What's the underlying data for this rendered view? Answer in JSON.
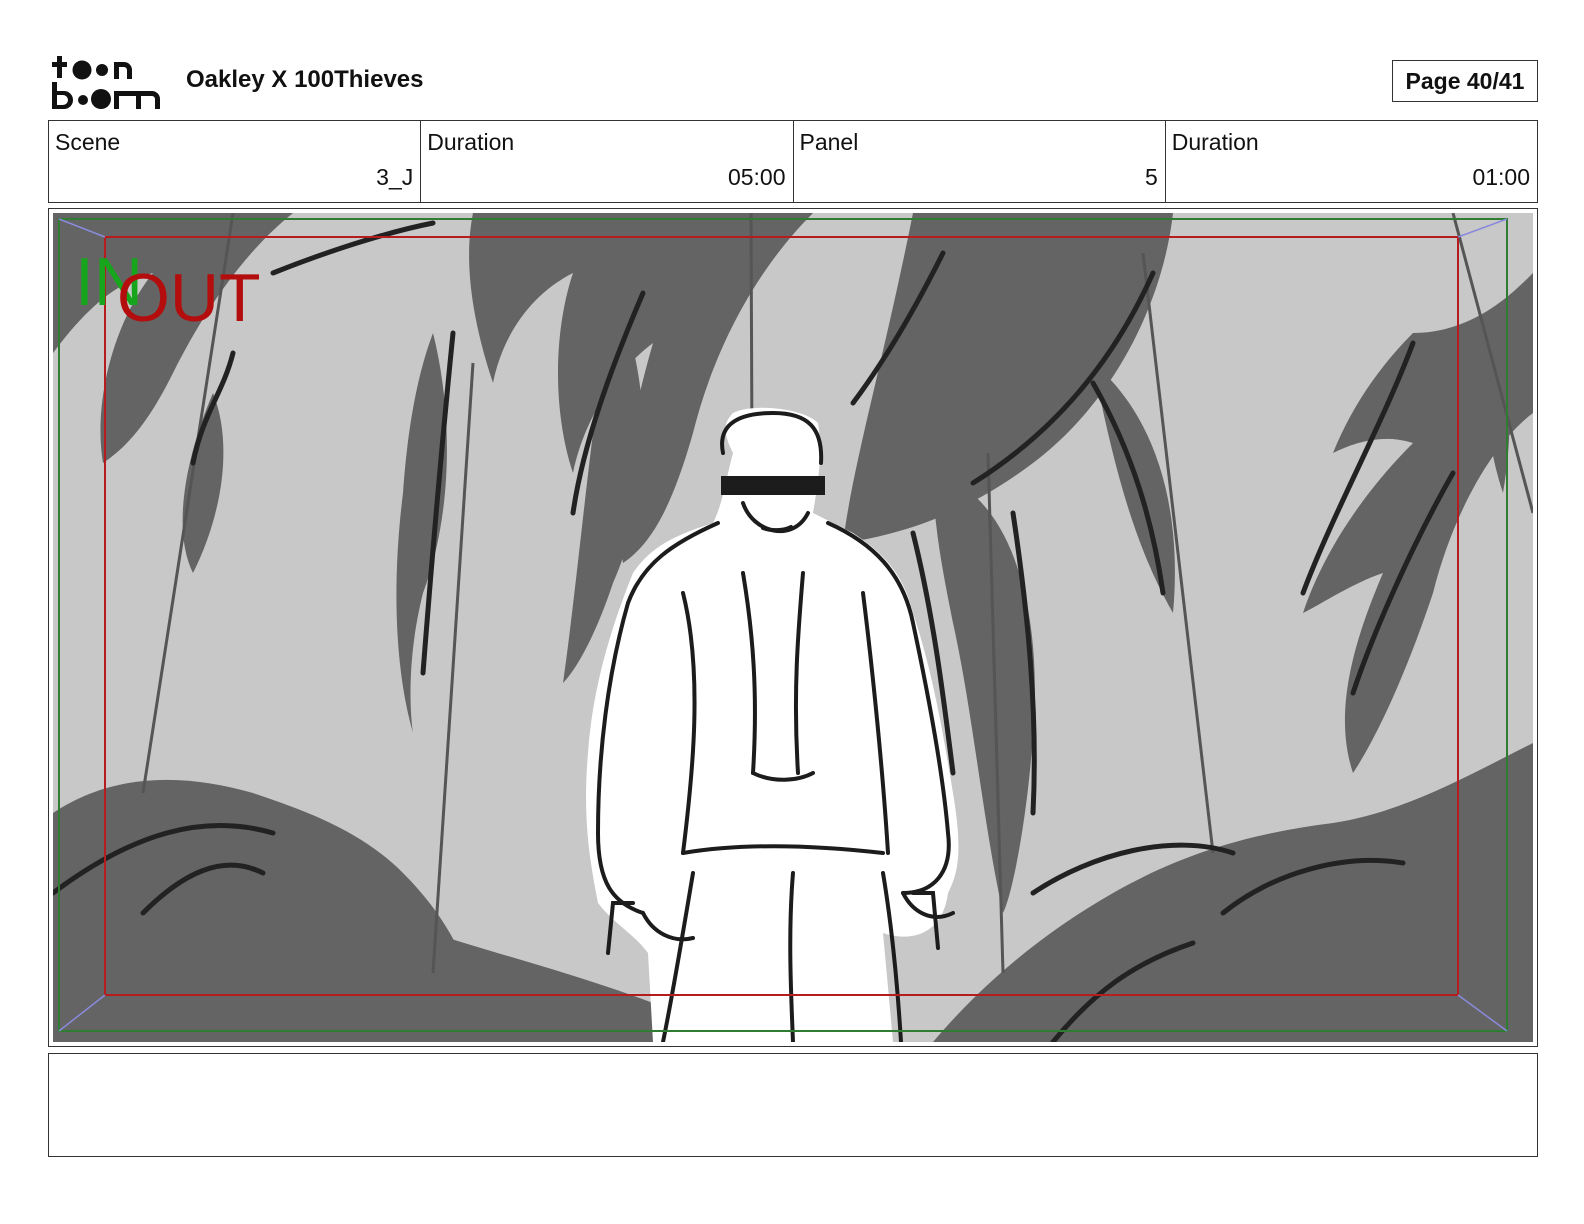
{
  "header": {
    "logo": {
      "icon": "toonboom-logo",
      "line1": "toon",
      "line2": "boom"
    },
    "project_title": "Oakley X 100Thieves",
    "page_label": "Page 40/41"
  },
  "info": {
    "scene_label": "Scene",
    "scene_value": "3_J",
    "scene_duration_label": "Duration",
    "scene_duration_value": "05:00",
    "panel_label": "Panel",
    "panel_value": "5",
    "panel_duration_label": "Duration",
    "panel_duration_value": "01:00"
  },
  "panel": {
    "in_marker": "IN",
    "out_marker": "OUT",
    "colors": {
      "in_marker": "#18a51e",
      "out_marker": "#b30d0d",
      "safe_frame": "#2e7d32",
      "title_safe": "#b71c1c",
      "background": "#c8c8c8",
      "shadow": "#646464"
    }
  },
  "notes": {
    "text": ""
  }
}
